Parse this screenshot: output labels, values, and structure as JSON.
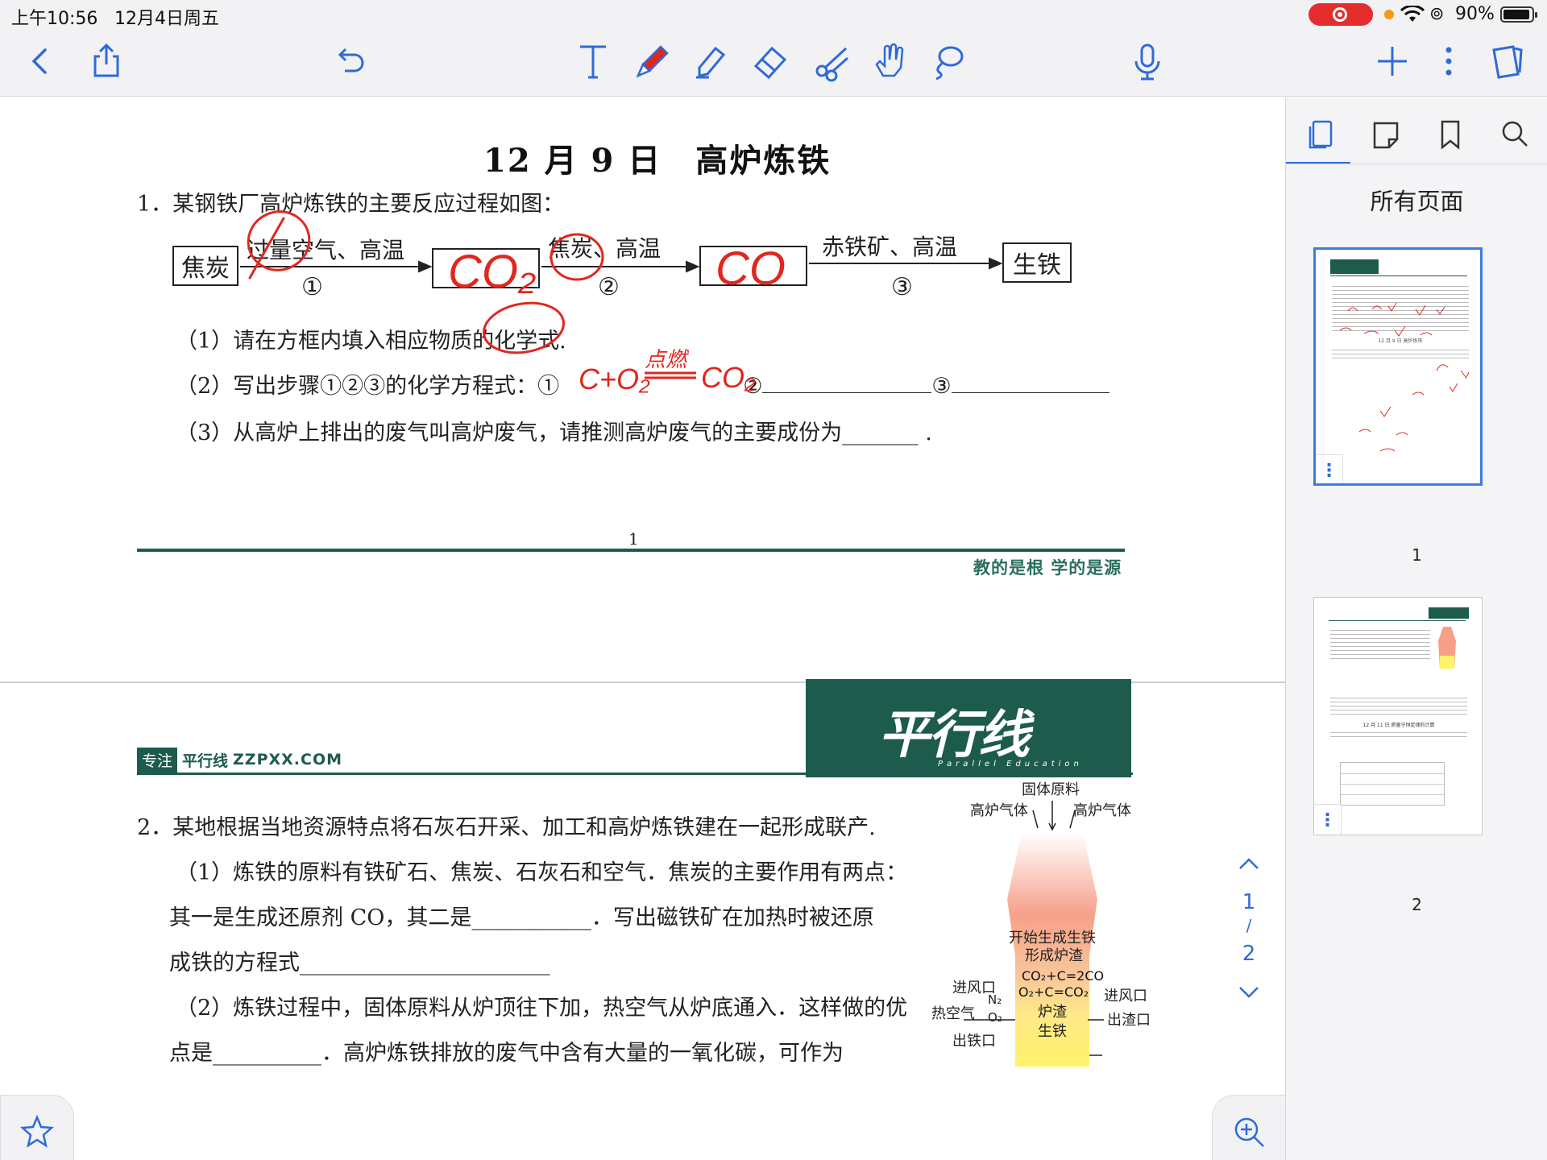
{
  "status_bar": {
    "time": "上午10:56",
    "date": "12月4日周五",
    "battery_percent": "90%",
    "battery_level": 0.9
  },
  "toolbar": {
    "icons": [
      "back-icon",
      "share-icon",
      "undo-icon",
      "text-tool-icon",
      "pen-tool-icon",
      "highlighter-icon",
      "eraser-icon",
      "scissors-icon",
      "hand-icon",
      "lasso-icon",
      "microphone-icon",
      "add-icon",
      "more-icon",
      "pages-icon"
    ],
    "accent_color": "#2f6bd8",
    "pen_color": "#e0271f"
  },
  "document": {
    "page1": {
      "title": "12 月 9 日　高炉炼铁",
      "q1_stem": "1．某钢铁厂高炉炼铁的主要反应过程如图：",
      "flow": {
        "start": "焦炭",
        "end": "生铁",
        "arrows": [
          {
            "label": "过量空气、高温",
            "step": "①"
          },
          {
            "label": "焦炭、高温",
            "step": "②"
          },
          {
            "label": "赤铁矿、高温",
            "step": "③"
          }
        ]
      },
      "sub1": "（1）请在方框内填入相应物质的化学式.",
      "sub2_prefix": "（2）写出步骤①②③的化学方程式：①",
      "sub2_mid1": "②",
      "sub2_mid2": "③",
      "sub3": "（3）从高炉上排出的废气叫高炉废气，请推测高炉废气的主要成份为_______ .",
      "handwriting": {
        "box1": "CO₂",
        "box2": "CO",
        "eq_left": "C+O₂",
        "eq_cond": "点燃",
        "eq_right": "CO₂"
      },
      "page_number": "1",
      "slogan": "教的是根  学的是源"
    },
    "page2": {
      "focus_tag": "专注",
      "brand_cn": "平行线",
      "brand_url": "ZZPXX.COM",
      "brand_logo": "平行线",
      "brand_sub": "Parallel Education",
      "q2_stem": "2．某地根据当地资源特点将石灰石开采、加工和高炉炼铁建在一起形成联产.",
      "q2_s1a": "（1）炼铁的原料有铁矿石、焦炭、石灰石和空气．焦炭的主要作用有两点：",
      "q2_s1b": "其一是生成还原剂 CO，其二是___________．写出磁铁矿在加热时被还原",
      "q2_s1c": "成铁的方程式_______________________",
      "q2_s2a": "（2）炼铁过程中，固体原料从炉顶往下加，热空气从炉底通入．这样做的优",
      "q2_s2b": "点是__________．高炉炼铁排放的废气中含有大量的一氧化碳，可作为",
      "furnace": {
        "top_label": "固体原料",
        "left_gas": "高炉气体",
        "right_gas": "高炉气体",
        "mid_label_1": "开始生成生铁",
        "mid_label_2": "形成炉渣",
        "eq1": "CO₂+C=2CO",
        "eq2": "O₂+C=CO₂",
        "slag": "炉渣",
        "iron": "生铁",
        "in_left": "进风口",
        "in_right": "进风口",
        "hot_air": "热空气",
        "n2": "N₂",
        "o2": "O₂",
        "slag_out": "出渣口",
        "iron_out": "出铁口"
      }
    },
    "nav": {
      "current": "1",
      "sep": "/",
      "total": "2"
    }
  },
  "sidebar": {
    "tabs": [
      "pages-tab-icon",
      "notes-tab-icon",
      "bookmark-tab-icon",
      "search-tab-icon"
    ],
    "heading": "所有页面",
    "thumbnails": [
      {
        "label": "1",
        "selected": true
      },
      {
        "label": "2",
        "selected": false
      }
    ],
    "thumb1_title": "12 月 9 日   高炉炼铁",
    "thumb2_title": "12 月 11 日   质量守恒定律的计算"
  }
}
